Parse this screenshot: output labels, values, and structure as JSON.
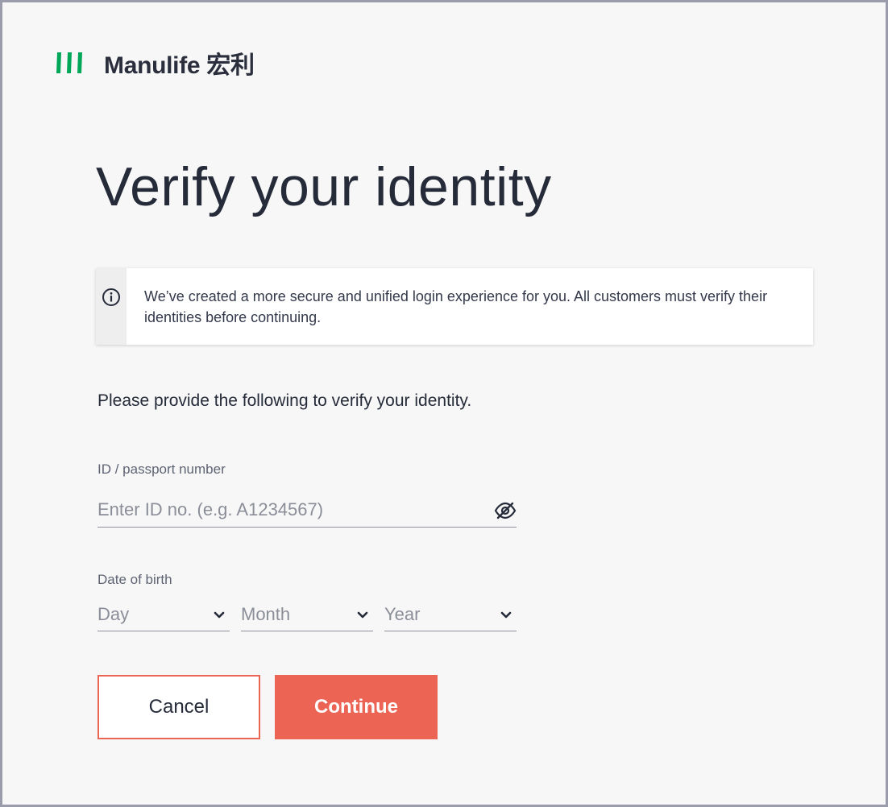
{
  "brand": {
    "logo_icon": "manulife-logo-icon",
    "name": "Manulife 宏利",
    "brand_color": "#00a758"
  },
  "page": {
    "title": "Verify your identity",
    "notice_icon": "info-icon",
    "notice_text": "We’ve created a more secure and unified login experience for you. All customers must verify their identities before continuing.",
    "prompt": "Please provide the following to verify your identity."
  },
  "form": {
    "id_label": "ID / passport number",
    "id_value": "",
    "id_placeholder": "Enter ID no. (e.g. A1234567)",
    "id_visibility_icon": "eye-off-icon",
    "dob_label": "Date of birth",
    "dob": {
      "day": "Day",
      "month": "Month",
      "year": "Year"
    }
  },
  "actions": {
    "cancel_label": "Cancel",
    "continue_label": "Continue",
    "accent_color": "#ec6453"
  }
}
